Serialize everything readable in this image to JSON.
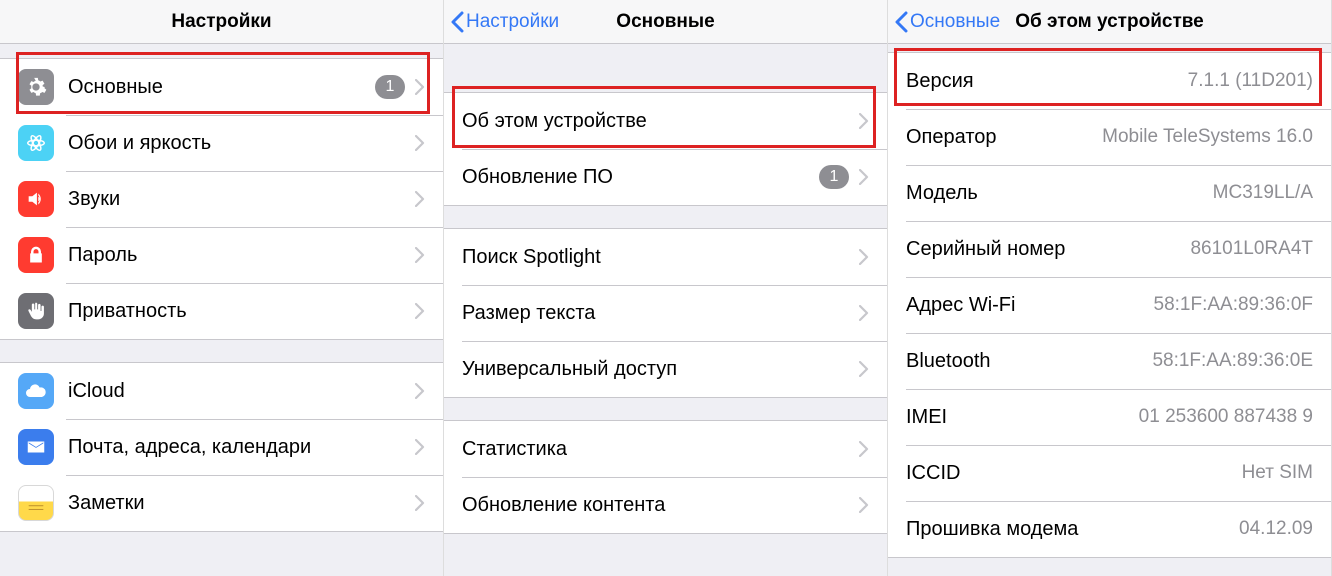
{
  "panel1": {
    "title": "Настройки",
    "rows": {
      "general": {
        "label": "Основные",
        "badge": "1"
      },
      "wallpaper": {
        "label": "Обои и яркость"
      },
      "sounds": {
        "label": "Звуки"
      },
      "passcode": {
        "label": "Пароль"
      },
      "privacy": {
        "label": "Приватность"
      },
      "icloud": {
        "label": "iCloud"
      },
      "mail": {
        "label": "Почта, адреса, календари"
      },
      "notes": {
        "label": "Заметки"
      }
    }
  },
  "panel2": {
    "back": "Настройки",
    "title": "Основные",
    "rows": {
      "about": {
        "label": "Об этом устройстве"
      },
      "update": {
        "label": "Обновление ПО",
        "badge": "1"
      },
      "spotlight": {
        "label": "Поиск Spotlight"
      },
      "textsize": {
        "label": "Размер текста"
      },
      "accessibility": {
        "label": "Универсальный доступ"
      },
      "stats": {
        "label": "Статистика"
      },
      "contentupdate": {
        "label": "Обновление контента"
      }
    }
  },
  "panel3": {
    "back": "Основные",
    "title": "Об этом устройстве",
    "rows": {
      "version": {
        "label": "Версия",
        "value": "7.1.1 (11D201)"
      },
      "carrier": {
        "label": "Оператор",
        "value": "Mobile TeleSystems 16.0"
      },
      "model": {
        "label": "Модель",
        "value": "MC319LL/A"
      },
      "serial": {
        "label": "Серийный номер",
        "value": "86101L0RA4T"
      },
      "wifi": {
        "label": "Адрес Wi-Fi",
        "value": "58:1F:AA:89:36:0F"
      },
      "bluetooth": {
        "label": "Bluetooth",
        "value": "58:1F:AA:89:36:0E"
      },
      "imei": {
        "label": "IMEI",
        "value": "01 253600 887438 9"
      },
      "iccid": {
        "label": "ICCID",
        "value": "Нет SIM"
      },
      "modem": {
        "label": "Прошивка модема",
        "value": "04.12.09"
      }
    }
  }
}
